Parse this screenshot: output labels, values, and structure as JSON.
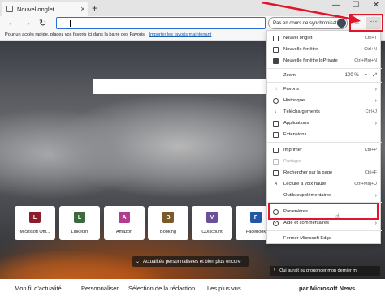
{
  "tab": {
    "title": "Nouvel onglet",
    "close": "×"
  },
  "tabstrip": {
    "new_tab": "+",
    "minimize": "—",
    "maximize": "☐",
    "close": "✕"
  },
  "toolbar": {
    "back": "←",
    "forward": "→",
    "refresh": "↻",
    "sync_label": "Pas en cours de synchronisation",
    "favorite_star": "☆",
    "more": "···"
  },
  "favbar": {
    "text": "Pour un accès rapide, placez vos favoris ici dans la barre des Favoris.",
    "link": "Importer les favoris maintenant"
  },
  "quick_links": [
    {
      "letter": "L",
      "label": "Microsoft Offi...",
      "color": "#8b1c2b"
    },
    {
      "letter": "L",
      "label": "Linkedin",
      "color": "#3c6b3a"
    },
    {
      "letter": "A",
      "label": "Amazon",
      "color": "#b23a8f"
    },
    {
      "letter": "B",
      "label": "Booking",
      "color": "#7a5a28"
    },
    {
      "letter": "V",
      "label": "CDiscount",
      "color": "#6a4f9a"
    },
    {
      "letter": "F",
      "label": "Facebook",
      "color": "#2456a4"
    }
  ],
  "news_button": "Actualités personnalisées et bien plus encore",
  "bing_caption": "Qui aurait pu prononcer mon dernier m",
  "bottom_nav": [
    "Mon fil d'actualité",
    "Personnaliser",
    "Sélection de la rédaction",
    "Les plus vus",
    "par Microsoft News"
  ],
  "menu": {
    "items": [
      {
        "label": "Nouvel onglet",
        "shortcut": "Ctrl+T"
      },
      {
        "label": "Nouvelle fenêtre",
        "shortcut": "Ctrl+N"
      },
      {
        "label": "Nouvelle fenêtre InPrivate",
        "shortcut": "Ctrl+Maj+N"
      },
      {
        "label": "Zoom",
        "zoom_minus": "—",
        "zoom_value": "100 %",
        "zoom_plus": "+",
        "expand": "⤢"
      },
      {
        "label": "Favoris",
        "arrow": "›"
      },
      {
        "label": "Historique",
        "arrow": "›"
      },
      {
        "label": "Téléchargements",
        "shortcut": "Ctrl+J"
      },
      {
        "label": "Applications",
        "arrow": "›"
      },
      {
        "label": "Extensions"
      },
      {
        "label": "Imprimer",
        "shortcut": "Ctrl+P"
      },
      {
        "label": "Partager"
      },
      {
        "label": "Rechercher sur la page",
        "shortcut": "Ctrl+F"
      },
      {
        "label": "Lecture à voix haute",
        "shortcut": "Ctrl+Maj+U"
      },
      {
        "label": "Outils supplémentaires",
        "arrow": "›"
      },
      {
        "label": "Paramètres"
      },
      {
        "label": "Aide et commentaires",
        "arrow": "›"
      },
      {
        "label": "Fermer Microsoft Edge"
      }
    ]
  },
  "colors": {
    "accent": "#2a6fd6",
    "highlight": "#e0162b"
  }
}
